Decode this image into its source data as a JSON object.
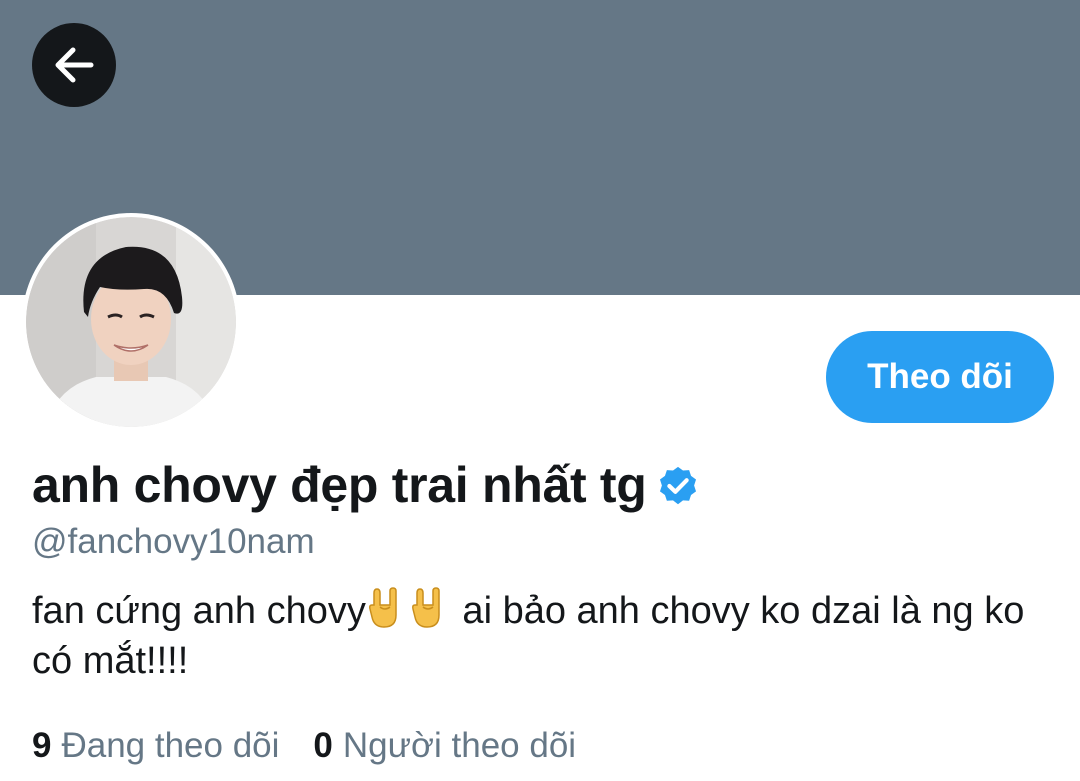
{
  "profile": {
    "display_name": "anh chovy đẹp trai nhất tg",
    "verified_icon": "verified-badge-icon",
    "handle": "@fanchovy10nam",
    "bio_part1": "fan cứng anh chovy",
    "bio_emoji": "rock-on-hand-icon",
    "bio_part2": " ai bảo anh chovy ko dzai là ng ko có mắt!!!!",
    "follow_label": "Theo dõi",
    "following_count": "9",
    "following_label": "Đang theo dõi",
    "followers_count": "0",
    "followers_label": "Người theo dõi"
  },
  "colors": {
    "banner": "#657786",
    "accent": "#2a9ff2",
    "text": "#14171a",
    "muted": "#657786"
  },
  "icons": {
    "back": "arrow-left-icon",
    "avatar": "profile-photo"
  }
}
